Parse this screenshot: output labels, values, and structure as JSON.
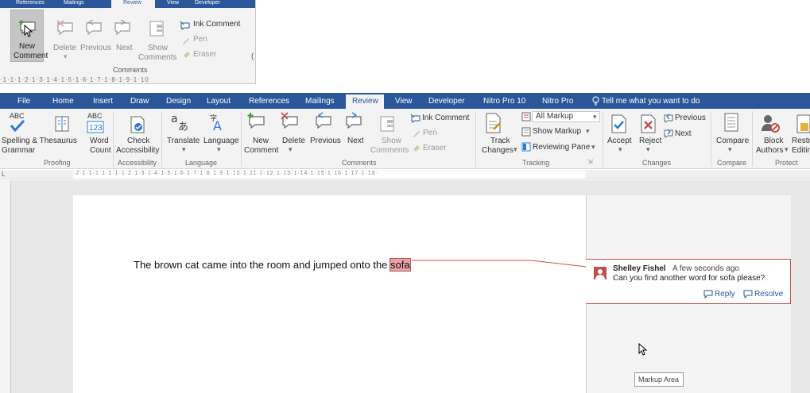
{
  "inset": {
    "tabs": [
      "References",
      "Mailings",
      "Review",
      "View",
      "Developer"
    ],
    "new_comment": [
      "New",
      "Comment"
    ],
    "delete": "Delete",
    "previous": "Previous",
    "next": "Next",
    "show_comments": [
      "Show",
      "Comments"
    ],
    "ink_comment": "Ink Comment",
    "pen": "Pen",
    "eraser": "Eraser",
    "group": "Comments",
    "ruler": "·1·1·1·2·1·3·1·4·1·5·1·6·1·7·1·8·1·9·1·10"
  },
  "tabs": [
    "File",
    "Home",
    "Insert",
    "Draw",
    "Design",
    "Layout",
    "References",
    "Mailings",
    "Review",
    "View",
    "Developer",
    "Nitro Pro 10",
    "Nitro Pro"
  ],
  "tell_me": "Tell me what you want to do",
  "ribbon": {
    "spelling": [
      "Spelling & Thesaurus",
      "Grammar"
    ],
    "word_count": [
      "Word",
      "Count"
    ],
    "check_access": [
      "Check",
      "Accessibility"
    ],
    "translate": "Translate",
    "language": "Language",
    "new_comment": [
      "New",
      "Comment"
    ],
    "delete": "Delete",
    "previous": "Previous",
    "next": "Next",
    "show_comments": [
      "Show",
      "Comments"
    ],
    "ink_comment": "Ink Comment",
    "pen": "Pen",
    "eraser": "Eraser",
    "track_changes": [
      "Track",
      "Changes"
    ],
    "all_markup": "All Markup",
    "show_markup": "Show Markup",
    "reviewing_pane": "Reviewing Pane",
    "accept": "Accept",
    "reject": "Reject",
    "ch_previous": "Previous",
    "ch_next": "Next",
    "compare": "Compare",
    "block_authors": [
      "Block",
      "Authors"
    ],
    "restrict": [
      "Restri",
      "Editin"
    ],
    "groups": {
      "proofing": "Proofing",
      "accessibility": "Accessibility",
      "language": "Language",
      "comments": "Comments",
      "tracking": "Tracking",
      "changes": "Changes",
      "compare": "Compare",
      "protect": "Protect"
    },
    "abc": "ABC",
    "abc_num": "123"
  },
  "ruler": "·2·1·1·1·1·1·1·1·2·1·3·1·4·1·5·1·6·1·7·1·8·1·9·1·10·1·11·1·12·1·13·1·14·1·15·1·16·1·17·1·18·",
  "document": {
    "text_before": "The brown cat came into the room and jumped onto the ",
    "highlight": "sofa"
  },
  "comment": {
    "author": "Shelley Fishel",
    "time": "A few seconds ago",
    "text": "Can you find another word for sofa please?",
    "reply": "Reply",
    "resolve": "Resolve"
  },
  "tooltip": "Markup Area",
  "colors": {
    "accent": "#2b579a",
    "markup": "#c0504d"
  }
}
